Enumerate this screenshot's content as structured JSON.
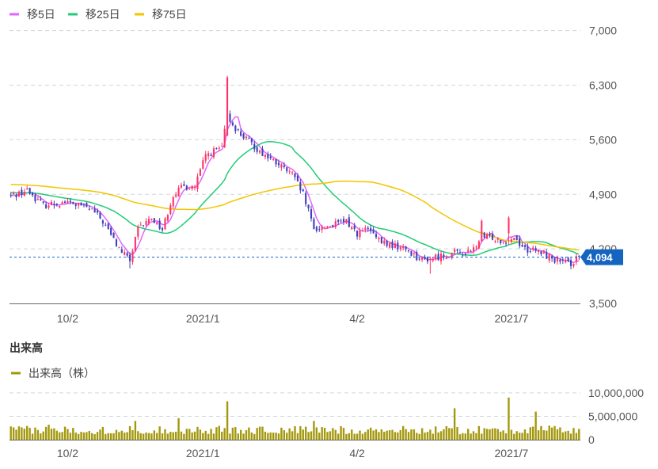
{
  "legend": [
    {
      "label": "移5日",
      "color": "#e066ff"
    },
    {
      "label": "移25日",
      "color": "#22cc77"
    },
    {
      "label": "移75日",
      "color": "#f2c500"
    }
  ],
  "volume_title": "出来高",
  "volume_legend": {
    "label": "出来高（株）",
    "color": "#a3980c"
  },
  "current_price": {
    "value": 4094,
    "label": "4,094",
    "color": "#1565c0"
  },
  "colors": {
    "up": "#ff3366",
    "down": "#4040bb",
    "volume": "#a3980c",
    "grid": "#cfd8dc",
    "axis": "#666666"
  },
  "chart_data": [
    {
      "type": "candlestick",
      "ylim": [
        3500,
        7200
      ],
      "yticks": [
        {
          "value": 3500,
          "label": "3,500"
        },
        {
          "value": 4200,
          "label": "4,200"
        },
        {
          "value": 4900,
          "label": "4,900"
        },
        {
          "value": 5600,
          "label": "5,600"
        },
        {
          "value": 6300,
          "label": "6,300"
        },
        {
          "value": 7000,
          "label": "7,000"
        }
      ],
      "xticks": [
        {
          "index": 21,
          "label": "10/2"
        },
        {
          "index": 71,
          "label": "2021/1"
        },
        {
          "index": 128,
          "label": "4/2"
        },
        {
          "index": 185,
          "label": "2021/7"
        }
      ],
      "n_days": 211,
      "price_keypoints": [
        [
          0,
          4880
        ],
        [
          6,
          4950
        ],
        [
          12,
          4760
        ],
        [
          20,
          4800
        ],
        [
          26,
          4750
        ],
        [
          30,
          4700
        ],
        [
          34,
          4550
        ],
        [
          40,
          4200
        ],
        [
          44,
          4050
        ],
        [
          47,
          4450
        ],
        [
          52,
          4600
        ],
        [
          56,
          4450
        ],
        [
          60,
          4900
        ],
        [
          64,
          5000
        ],
        [
          68,
          5000
        ],
        [
          72,
          5400
        ],
        [
          78,
          5500
        ],
        [
          80,
          5900
        ],
        [
          84,
          5700
        ],
        [
          92,
          5450
        ],
        [
          98,
          5300
        ],
        [
          104,
          5150
        ],
        [
          108,
          4900
        ],
        [
          112,
          4450
        ],
        [
          118,
          4500
        ],
        [
          124,
          4550
        ],
        [
          128,
          4400
        ],
        [
          132,
          4450
        ],
        [
          136,
          4300
        ],
        [
          140,
          4250
        ],
        [
          146,
          4200
        ],
        [
          152,
          4050
        ],
        [
          158,
          4100
        ],
        [
          164,
          4150
        ],
        [
          170,
          4150
        ],
        [
          174,
          4350
        ],
        [
          178,
          4350
        ],
        [
          182,
          4300
        ],
        [
          186,
          4350
        ],
        [
          190,
          4200
        ],
        [
          196,
          4150
        ],
        [
          202,
          4050
        ],
        [
          206,
          4000
        ],
        [
          210,
          4094
        ]
      ],
      "events": [
        {
          "index": 80,
          "high": 6420,
          "open": 5650,
          "close": 6400
        },
        {
          "index": 174,
          "high": 4580,
          "open": 4300,
          "close": 4560
        },
        {
          "index": 184,
          "high": 4620,
          "open": 4400,
          "close": 4600
        },
        {
          "index": 155,
          "low": 3880
        },
        {
          "index": 44,
          "low": 3950
        }
      ],
      "ma": [
        {
          "name": "移5日",
          "period": 5,
          "color": "#e066ff"
        },
        {
          "name": "移25日",
          "period": 25,
          "color": "#22cc77"
        },
        {
          "name": "移75日",
          "period": 75,
          "color": "#f2c500"
        }
      ]
    },
    {
      "type": "bar",
      "series_name": "出来高（株）",
      "ylim": [
        0,
        11000000
      ],
      "yticks": [
        {
          "value": 0,
          "label": "0"
        },
        {
          "value": 5000000,
          "label": "5,000,000"
        },
        {
          "value": 10000000,
          "label": "10,000,000"
        }
      ],
      "base_volume": 2100000,
      "spikes": [
        {
          "index": 14,
          "value": 3200000
        },
        {
          "index": 46,
          "value": 4000000
        },
        {
          "index": 62,
          "value": 4600000
        },
        {
          "index": 80,
          "value": 8200000
        },
        {
          "index": 112,
          "value": 4000000
        },
        {
          "index": 164,
          "value": 6700000
        },
        {
          "index": 184,
          "value": 9000000
        },
        {
          "index": 194,
          "value": 6000000
        },
        {
          "index": 199,
          "value": 3000000
        }
      ]
    }
  ]
}
